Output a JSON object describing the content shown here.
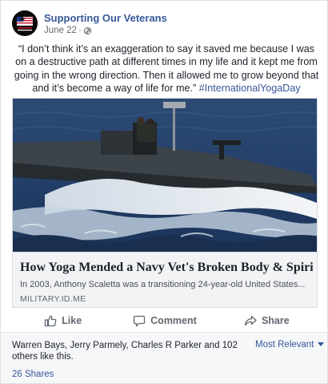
{
  "post": {
    "page_name": "Supporting Our Veterans",
    "date": "June 22",
    "separator": " · ",
    "privacy_icon": "globe-icon",
    "text": "“I don’t think it’s an exaggeration to say it saved me because I was on a destructive path at different times in my life and it kept me from going in the wrong direction. Then it allowed me to grow beyond that and it’s become a way of life for me.” ",
    "hashtag": "#InternationalYogaDay",
    "avatar_text": "Support Our Troops"
  },
  "link_card": {
    "title": "How Yoga Mended a Navy Vet's Broken Body & Spirit",
    "description": "In 2003, Anthony Scaletta was a transitioning 24-year-old United States...",
    "domain": "MILITARY.ID.ME"
  },
  "actions": {
    "like": "Like",
    "comment": "Comment",
    "share": "Share"
  },
  "footer": {
    "reactions": "Warren Bays, Jerry Parmely, Charles R Parker and 102 others like this.",
    "sort": "Most Relevant",
    "shares": "26 Shares"
  },
  "colors": {
    "link_blue": "#365899",
    "secondary_text": "#616770",
    "card_background": "#f2f3f5"
  }
}
